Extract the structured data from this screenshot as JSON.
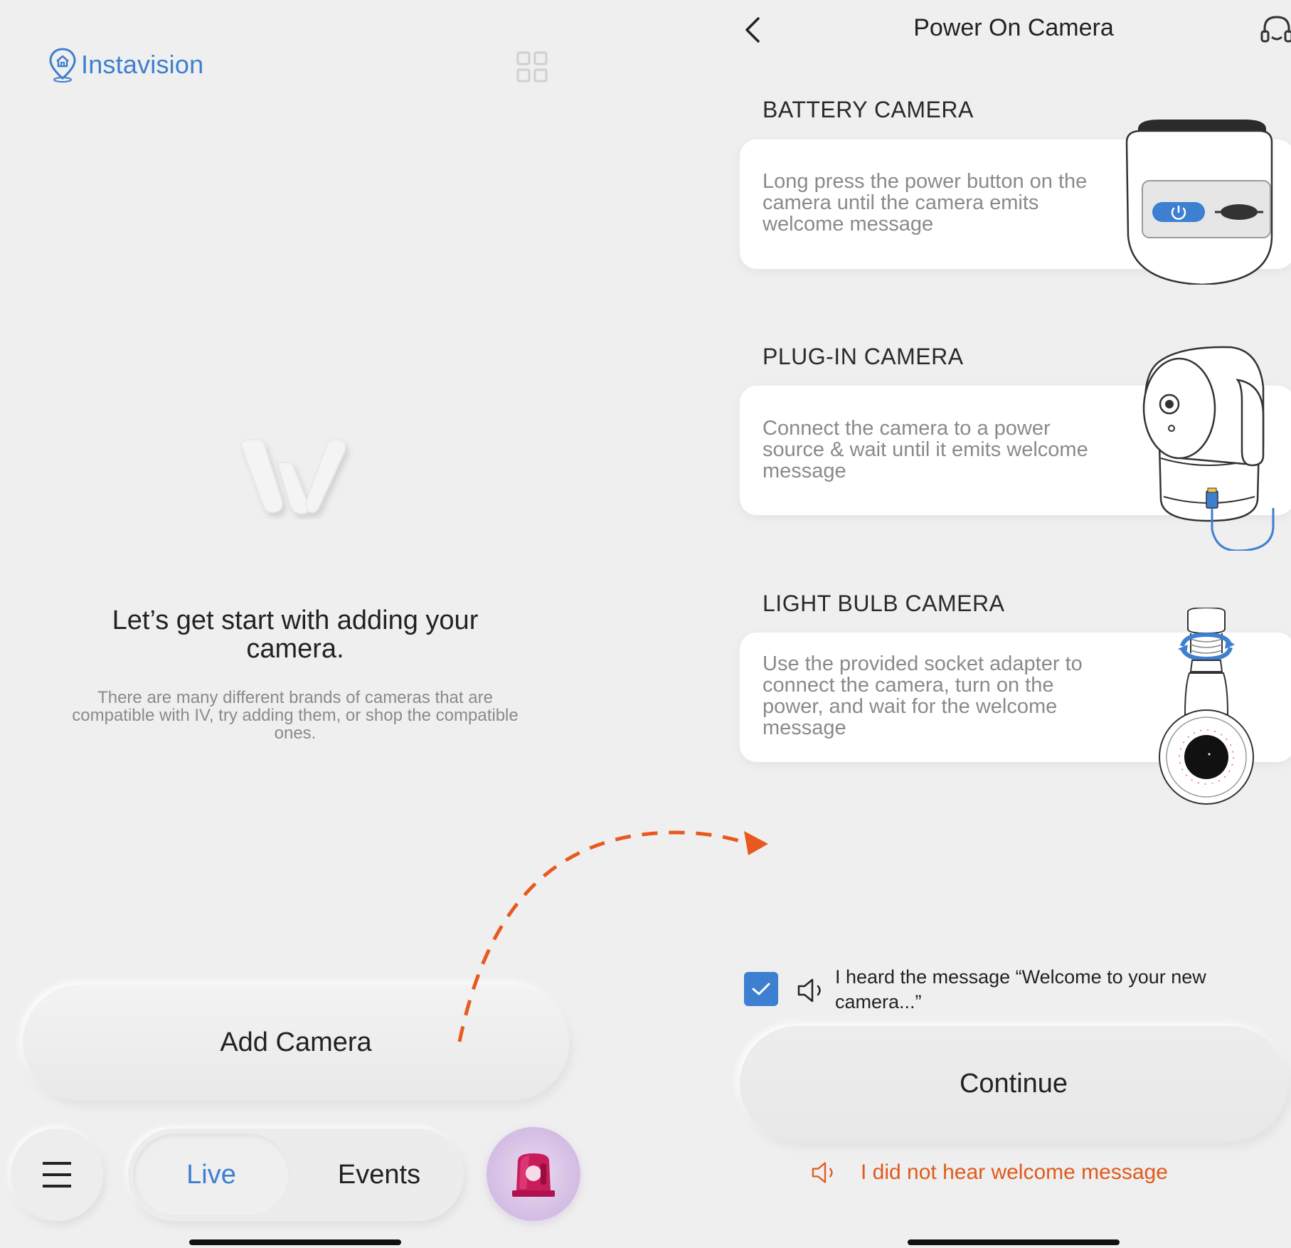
{
  "left_screen": {
    "brand": {
      "name": "Instavision",
      "color": "#3d7fd0"
    },
    "empty_state": {
      "title": "Let’s get start with adding your camera.",
      "subtitle": "There are many different brands of cameras that are compatible with IV, try adding them, or shop the compatible ones."
    },
    "add_camera_label": "Add Camera",
    "bottom_nav": {
      "live_label": "Live",
      "events_label": "Events",
      "icons": [
        "menu-icon",
        "siren-icon"
      ]
    }
  },
  "right_screen": {
    "title": "Power On Camera",
    "sections": [
      {
        "heading": "BATTERY CAMERA",
        "description": "Long press the power button on the camera until the camera emits welcome message",
        "icon": "battery-camera-illustration"
      },
      {
        "heading": "PLUG-IN CAMERA",
        "description": "Connect the camera to a power source & wait until it emits welcome message",
        "icon": "plugin-camera-illustration"
      },
      {
        "heading": "LIGHT BULB CAMERA",
        "description": "Use the provided socket adapter to connect the camera, turn on the power, and wait for the welcome message",
        "icon": "lightbulb-camera-illustration"
      }
    ],
    "confirmation": {
      "checked": true,
      "text": "I heard the message “Welcome to your new camera...”"
    },
    "continue_label": "Continue",
    "not_heard_label": "I did not hear welcome message"
  },
  "colors": {
    "accent_blue": "#3d7fd0",
    "warning_orange": "#e05a1b",
    "background": "#efefef"
  }
}
